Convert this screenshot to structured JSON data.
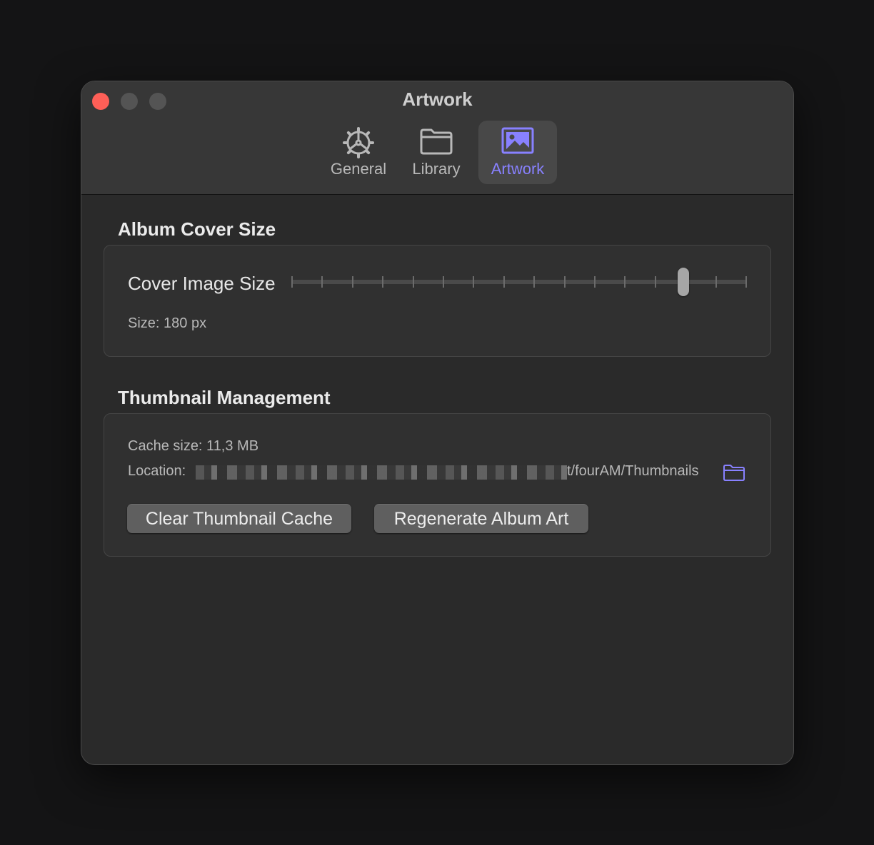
{
  "window": {
    "title": "Artwork"
  },
  "tabs": [
    {
      "label": "General",
      "icon": "gear-icon"
    },
    {
      "label": "Library",
      "icon": "folder-icon"
    },
    {
      "label": "Artwork",
      "icon": "photo-icon",
      "active": true
    }
  ],
  "album_cover": {
    "section_title": "Album Cover Size",
    "slider_label": "Cover Image Size",
    "slider_value_fraction": 0.86,
    "size_text": "Size: 180 px"
  },
  "thumbnails": {
    "section_title": "Thumbnail Management",
    "cache_text": "Cache size: 11,3 MB",
    "location_label": "Location:",
    "location_path": "t/fourAM/Thumbnails",
    "clear_button": "Clear Thumbnail Cache",
    "regenerate_button": "Regenerate Album Art"
  },
  "colors": {
    "accent": "#8881ff",
    "close": "#fe5f57"
  }
}
